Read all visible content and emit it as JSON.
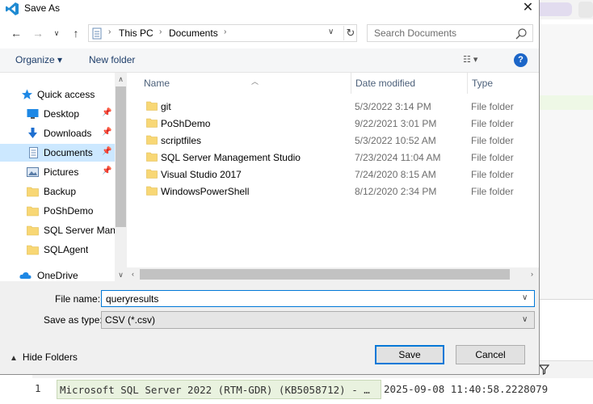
{
  "window": {
    "title": "Save As"
  },
  "nav": {
    "back_glyph": "←",
    "forward_glyph": "→",
    "recent_glyph": "∨",
    "up_glyph": "↑"
  },
  "address": {
    "crumbs": [
      "This PC",
      "Documents"
    ],
    "separator": "›"
  },
  "search": {
    "placeholder": "Search Documents"
  },
  "toolbar": {
    "organize_label": "Organize ▾",
    "new_folder_label": "New folder",
    "views_glyph": "☷ ▾",
    "help_glyph": "?"
  },
  "sidebar": {
    "items": [
      {
        "label": "Quick access",
        "icon": "star-icon"
      },
      {
        "label": "Desktop",
        "icon": "desktop-icon",
        "pinned": true
      },
      {
        "label": "Downloads",
        "icon": "download-icon",
        "pinned": true
      },
      {
        "label": "Documents",
        "icon": "documents-icon",
        "pinned": true,
        "selected": true
      },
      {
        "label": "Pictures",
        "icon": "pictures-icon",
        "pinned": true
      },
      {
        "label": "Backup",
        "icon": "folder-icon"
      },
      {
        "label": "PoShDemo",
        "icon": "folder-icon"
      },
      {
        "label": "SQL Server Mana",
        "icon": "folder-icon"
      },
      {
        "label": "SQLAgent",
        "icon": "folder-icon"
      },
      {
        "label": "OneDrive",
        "icon": "cloud-icon"
      }
    ]
  },
  "file_list": {
    "columns": [
      "Name",
      "Date modified",
      "Type"
    ],
    "rows": [
      {
        "name": "git",
        "date": "5/3/2022 3:14 PM",
        "type": "File folder"
      },
      {
        "name": "PoShDemo",
        "date": "9/22/2021 3:01 PM",
        "type": "File folder"
      },
      {
        "name": "scriptfiles",
        "date": "5/3/2022 10:52 AM",
        "type": "File folder"
      },
      {
        "name": "SQL Server Management Studio",
        "date": "7/23/2024 11:04 AM",
        "type": "File folder"
      },
      {
        "name": "Visual Studio 2017",
        "date": "7/24/2020 8:15 AM",
        "type": "File folder"
      },
      {
        "name": "WindowsPowerShell",
        "date": "8/12/2020 2:34 PM",
        "type": "File folder"
      }
    ]
  },
  "form": {
    "file_name_label": "File name:",
    "file_name_value": "queryresults",
    "save_type_label": "Save as type:",
    "save_type_value": "CSV (*.csv)"
  },
  "footer": {
    "hide_folders_label": "Hide Folders",
    "save_label": "Save",
    "cancel_label": "Cancel"
  },
  "background": {
    "row_number": "1",
    "version_cell": "Microsoft SQL Server 2022 (RTM-GDR) (KB5058712) - …",
    "date_cell": "2025-09-08 11:40:58.2228079"
  },
  "colors": {
    "accent": "#0078d7",
    "selection": "#cce8ff",
    "folder": "#f8d775"
  }
}
